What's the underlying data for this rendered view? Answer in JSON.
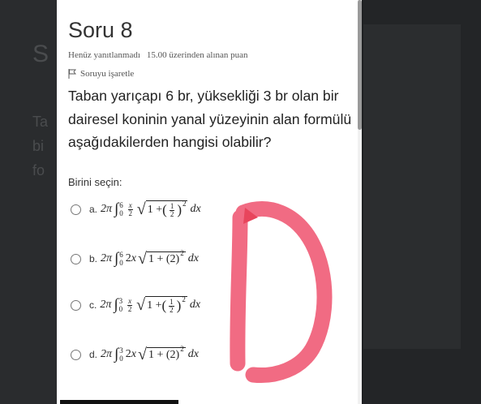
{
  "question": {
    "title": "Soru 8",
    "status": "Henüz yanıtlanmadı",
    "points": "15.00 üzerinden alınan puan",
    "flag_label": "Soruyu işaretle",
    "text": "Taban yarıçapı 6 br, yüksekliği 3 br olan bir dairesel koninin yanal yüzeyinin alan formülü aşağıdakilerden hangisi olabilir?",
    "instruction": "Birini seçin:"
  },
  "options": [
    {
      "letter": "a.",
      "coef": "2π",
      "upper": "6",
      "lower": "0",
      "integrand_prefix": "x/2",
      "radicand": "1 + (1/2)²",
      "dx": "dx"
    },
    {
      "letter": "b.",
      "coef": "2π",
      "upper": "6",
      "lower": "0",
      "integrand_prefix": "2x",
      "radicand": "1 + (2)²",
      "dx": "dx"
    },
    {
      "letter": "c.",
      "coef": "2π",
      "upper": "3",
      "lower": "0",
      "integrand_prefix": "x/2",
      "radicand": "1 + (1/2)²",
      "dx": "dx"
    },
    {
      "letter": "d.",
      "coef": "2π",
      "upper": "3",
      "lower": "0",
      "integrand_prefix": "2x",
      "radicand": "1 + (2)²",
      "dx": "dx"
    }
  ],
  "annotation": {
    "text": "D",
    "color": "#f0607a"
  },
  "colors": {
    "card": "#ffffff",
    "overlay": "#1e2022",
    "text": "#222222"
  }
}
